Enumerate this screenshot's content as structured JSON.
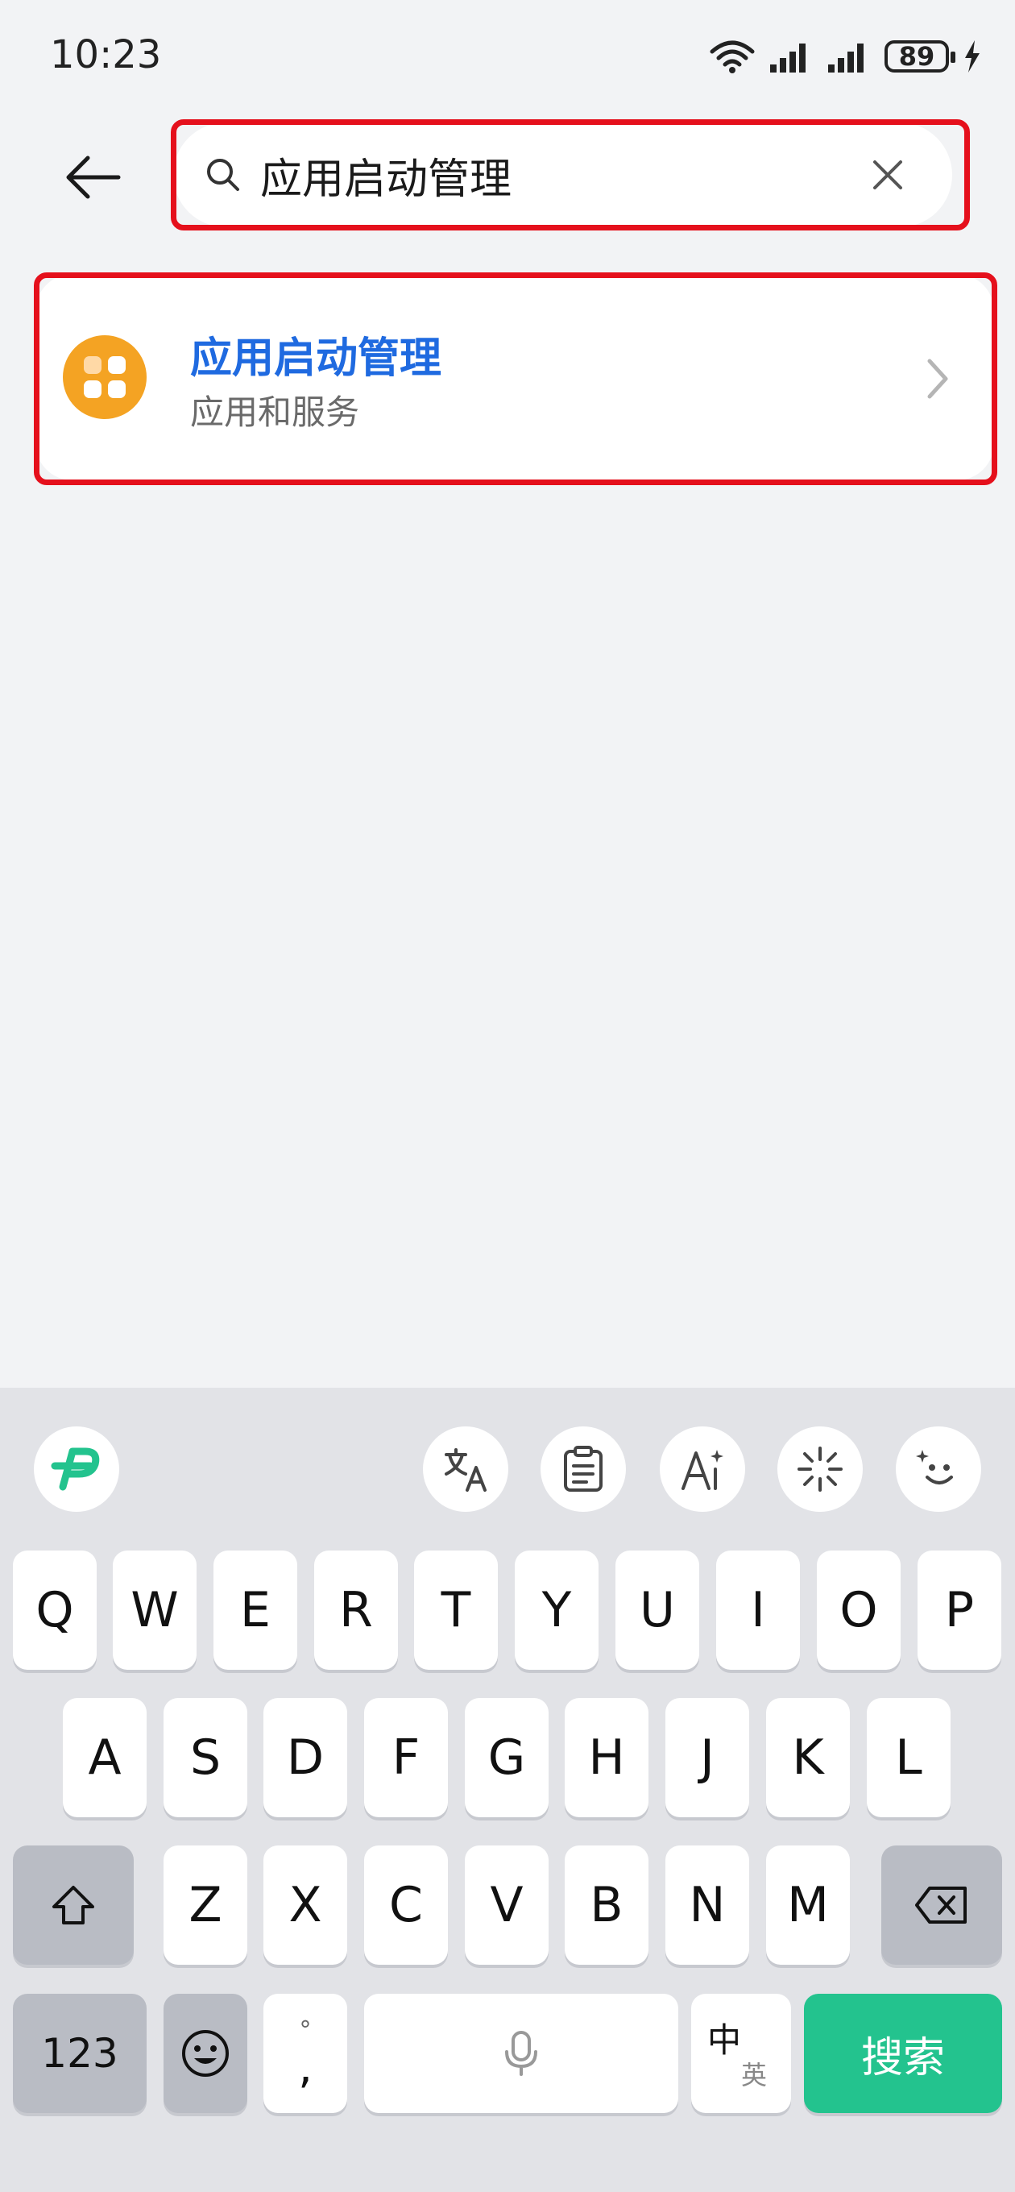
{
  "status_bar": {
    "time": "10:23",
    "battery": "89"
  },
  "header": {
    "search_value": "应用启动管理"
  },
  "results": [
    {
      "title": "应用启动管理",
      "subtitle": "应用和服务"
    }
  ],
  "keyboard": {
    "row1": [
      "Q",
      "W",
      "E",
      "R",
      "T",
      "Y",
      "U",
      "I",
      "O",
      "P"
    ],
    "row2": [
      "A",
      "S",
      "D",
      "F",
      "G",
      "H",
      "J",
      "K",
      "L"
    ],
    "row3": [
      "Z",
      "X",
      "C",
      "V",
      "B",
      "N",
      "M"
    ],
    "num_key": "123",
    "punct_top": "°",
    "punct_bottom": ",",
    "lang_zh": "中",
    "lang_en": "英",
    "search_label": "搜索"
  },
  "colors": {
    "accent_blue": "#1f6ae0",
    "search_green": "#23c38e",
    "annotation_red": "#e5101c",
    "app_icon_orange": "#f4a323"
  }
}
